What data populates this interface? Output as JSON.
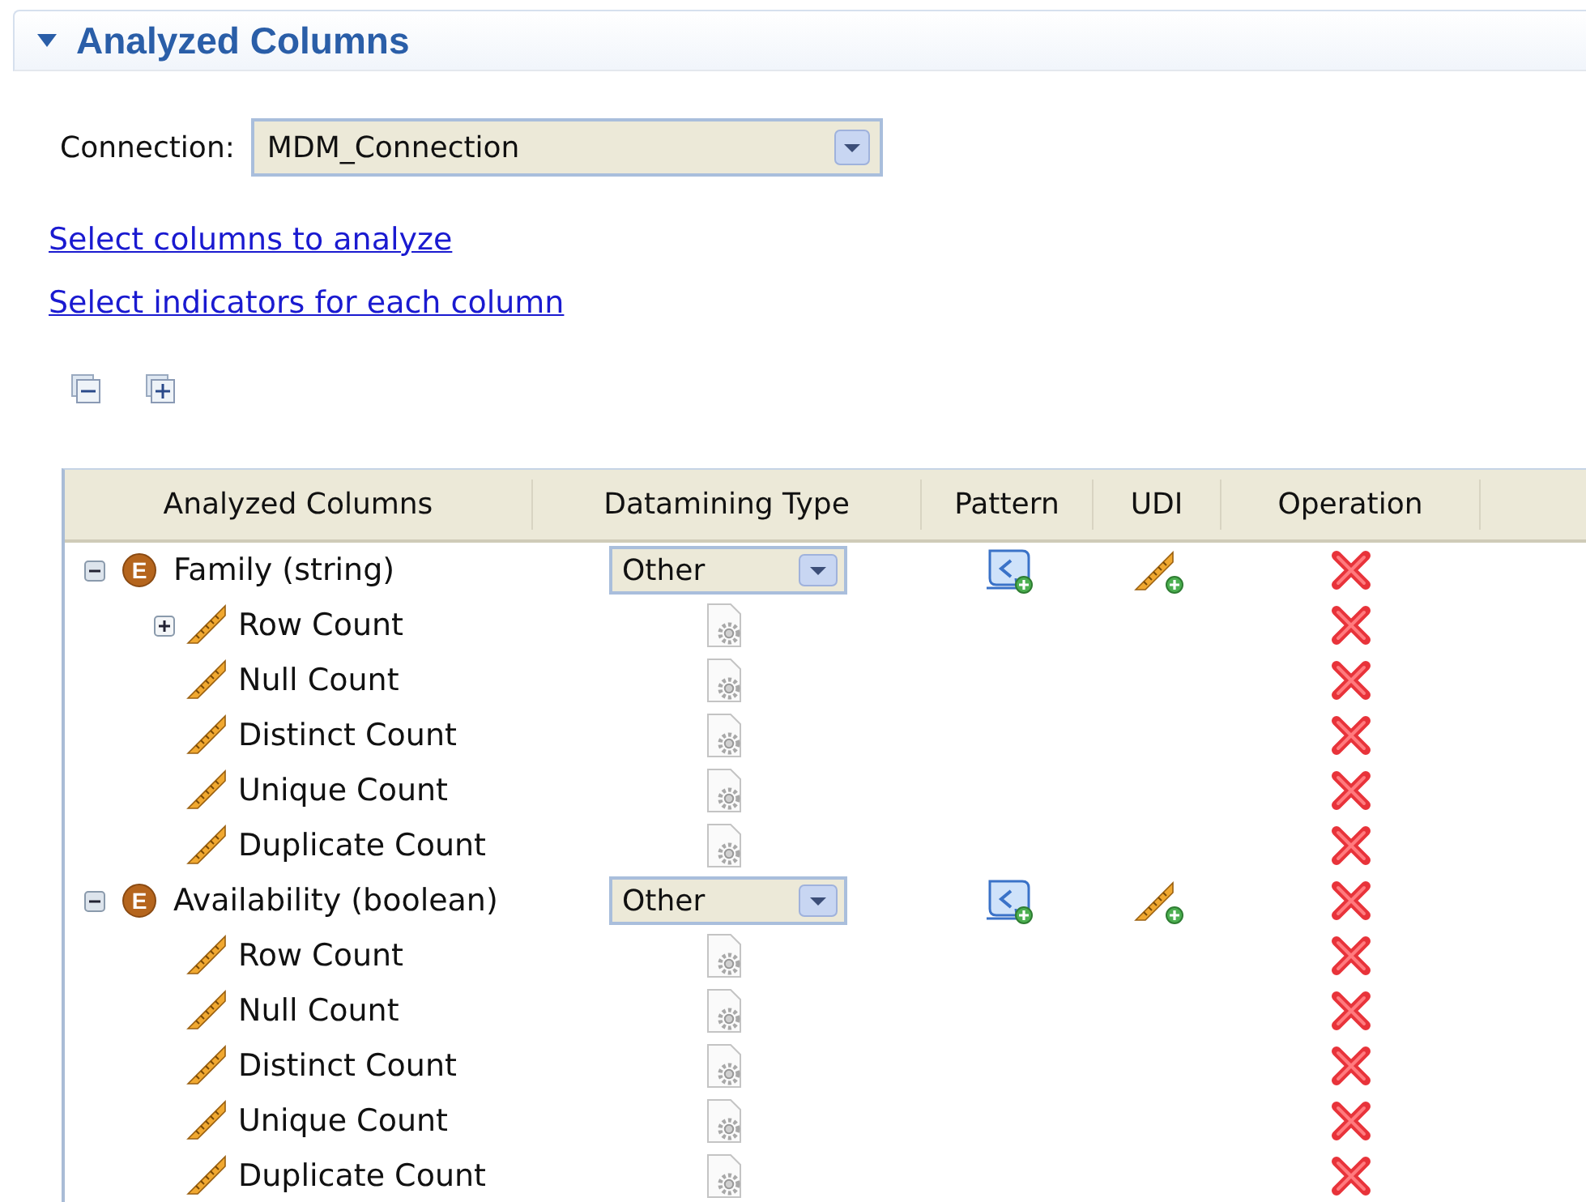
{
  "section": {
    "title": "Analyzed Columns",
    "expanded": true
  },
  "connection": {
    "label": "Connection:",
    "value": "MDM_Connection"
  },
  "links": [
    "Select columns to analyze",
    "Select indicators for each column"
  ],
  "table": {
    "columns": [
      "Analyzed Columns",
      "Datamining Type",
      "Pattern",
      "UDI",
      "Operation"
    ],
    "rows": [
      {
        "name": "Family (string)",
        "icon_letter": "E",
        "datamining_type": "Other",
        "expanded": true,
        "children": [
          {
            "name": "Row Count",
            "kind": "expandable",
            "expanded": false
          },
          {
            "name": "Null Count",
            "kind": "plain"
          },
          {
            "name": "Distinct Count",
            "kind": "plain"
          },
          {
            "name": "Unique Count",
            "kind": "plain"
          },
          {
            "name": "Duplicate Count",
            "kind": "plain"
          }
        ]
      },
      {
        "name": "Availability (boolean)",
        "icon_letter": "E",
        "datamining_type": "Other",
        "expanded": true,
        "children": [
          {
            "name": "Row Count",
            "kind": "plain"
          },
          {
            "name": "Null Count",
            "kind": "plain"
          },
          {
            "name": "Distinct Count",
            "kind": "plain"
          },
          {
            "name": "Unique Count",
            "kind": "plain"
          },
          {
            "name": "Duplicate Count",
            "kind": "plain"
          }
        ]
      }
    ]
  }
}
